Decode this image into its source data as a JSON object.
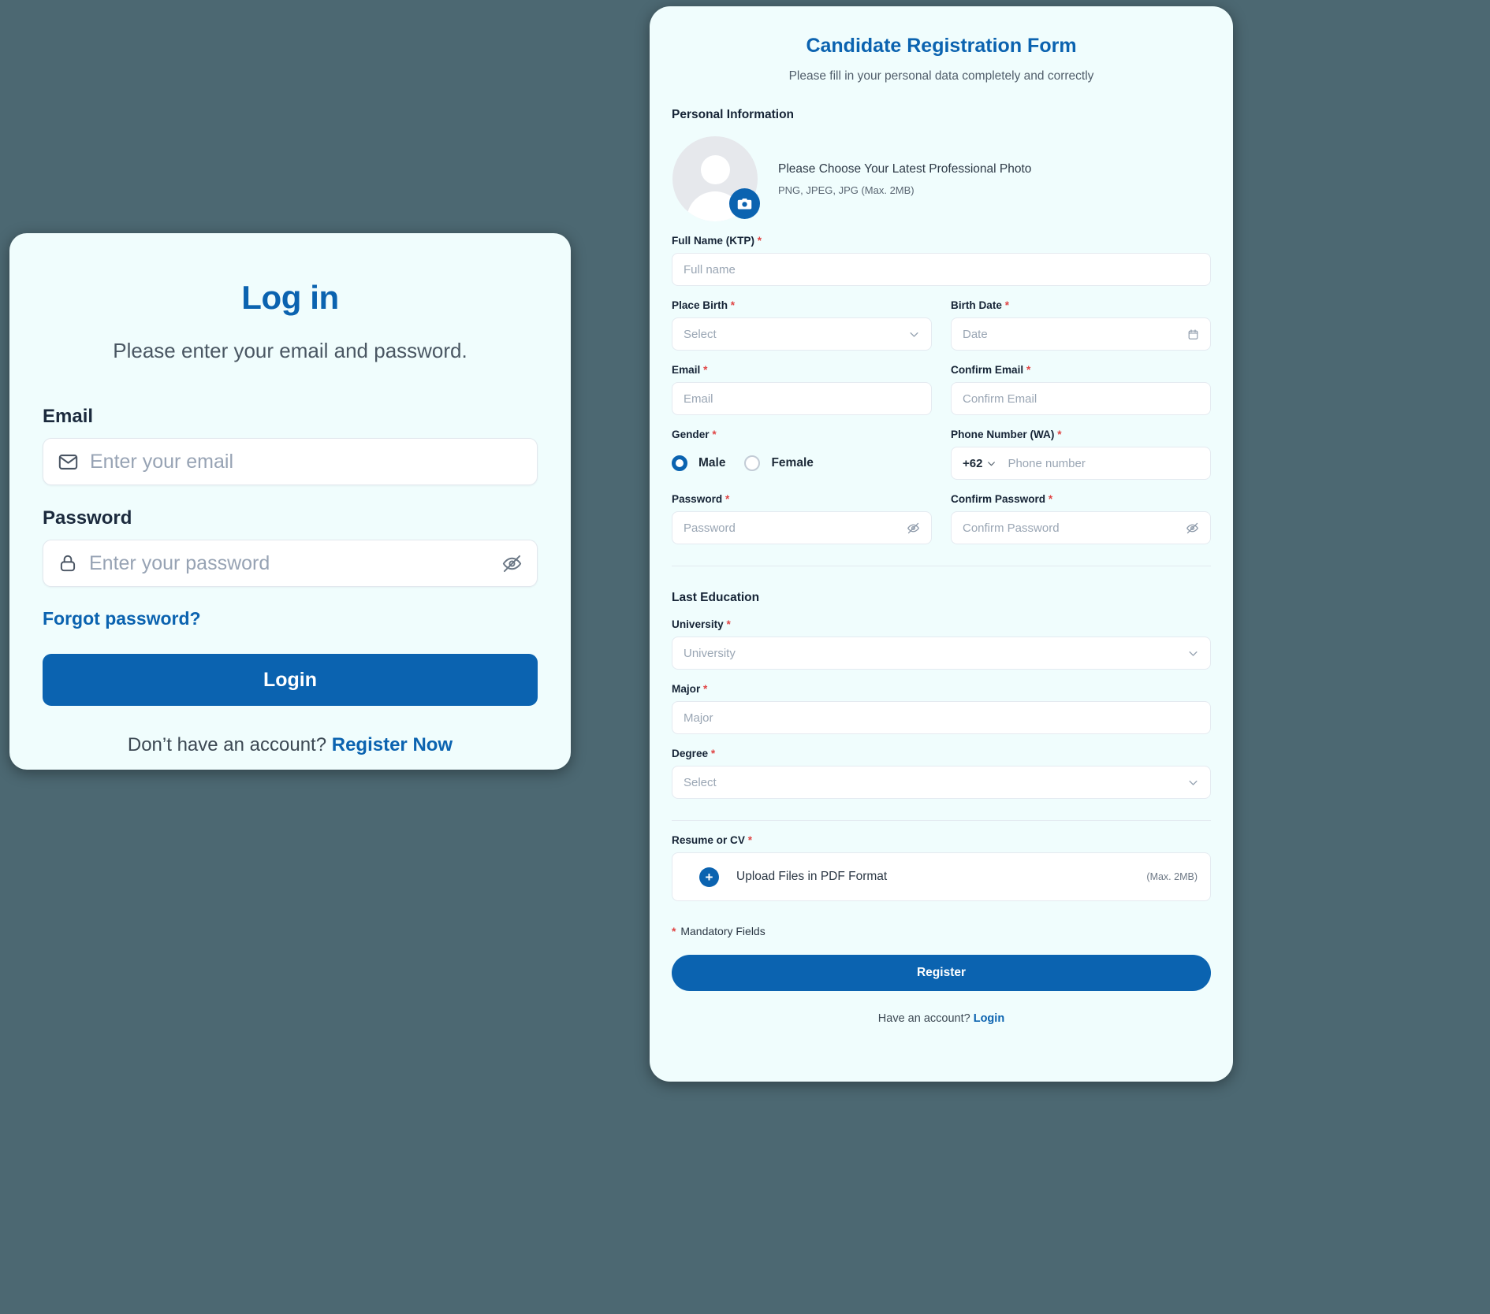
{
  "theme": {
    "page_background": "#4c6872",
    "card_background": "#f0fdfd",
    "accent": "#0b63b0",
    "required_marker": "#e04545",
    "placeholder": "#9aa6b4"
  },
  "login": {
    "title": "Log in",
    "subtitle": "Please enter your email and password.",
    "email": {
      "label": "Email",
      "placeholder": "Enter your email",
      "value": "",
      "icon": "mail-icon"
    },
    "password": {
      "label": "Password",
      "placeholder": "Enter your password",
      "value": "",
      "icon": "lock-icon",
      "toggle_icon": "eye-off-icon"
    },
    "forgot_password": "Forgot password?",
    "submit_label": "Login",
    "footer_text": "Don’t have an account?",
    "footer_link": "Register Now"
  },
  "register": {
    "title": "Candidate Registration Form",
    "subtitle": "Please fill in your personal data completely and correctly",
    "sections": {
      "personal": "Personal Information",
      "education": "Last Education"
    },
    "photo": {
      "main_text": "Please Choose Your Latest Professional Photo",
      "sub_text": "PNG, JPEG, JPG (Max. 2MB)",
      "avatar_icon": "user-avatar-icon",
      "badge_icon": "camera-icon"
    },
    "fields": {
      "full_name": {
        "label": "Full Name (KTP)",
        "required": true,
        "placeholder": "Full name",
        "value": ""
      },
      "place_birth": {
        "label": "Place Birth",
        "required": true,
        "placeholder": "Select",
        "value": "",
        "type": "select",
        "icon": "chevron-down-icon"
      },
      "birth_date": {
        "label": "Birth Date",
        "required": true,
        "placeholder": "Date",
        "value": "",
        "type": "date",
        "icon": "calendar-icon"
      },
      "email": {
        "label": "Email",
        "required": true,
        "placeholder": "Email",
        "value": ""
      },
      "confirm_email": {
        "label": "Confirm Email",
        "required": true,
        "placeholder": "Confirm Email",
        "value": ""
      },
      "gender": {
        "label": "Gender",
        "required": true,
        "options": [
          "Male",
          "Female"
        ],
        "selected": "Male"
      },
      "phone": {
        "label": "Phone Number (WA)",
        "required": true,
        "country_code": "+62",
        "placeholder": "Phone number",
        "value": "",
        "icon": "chevron-down-icon"
      },
      "password": {
        "label": "Password",
        "required": true,
        "placeholder": "Password",
        "value": "",
        "toggle_icon": "eye-off-icon"
      },
      "confirm_password": {
        "label": "Confirm Password",
        "required": true,
        "placeholder": "Confirm Password",
        "value": "",
        "toggle_icon": "eye-off-icon"
      },
      "university": {
        "label": "University",
        "required": true,
        "placeholder": "University",
        "value": "",
        "type": "select",
        "icon": "chevron-down-icon"
      },
      "major": {
        "label": "Major",
        "required": true,
        "placeholder": "Major",
        "value": ""
      },
      "degree": {
        "label": "Degree",
        "required": true,
        "placeholder": "Select",
        "value": "",
        "type": "select",
        "icon": "chevron-down-icon"
      },
      "resume": {
        "label": "Resume or CV",
        "required": true,
        "upload_text": "Upload Files in PDF Format",
        "max_size": "(Max. 2MB)",
        "icon": "plus-circle-icon"
      }
    },
    "mandatory_note_marker": "*",
    "mandatory_note": "Mandatory Fields",
    "submit_label": "Register",
    "footer_text": "Have an account?",
    "footer_link": "Login"
  }
}
